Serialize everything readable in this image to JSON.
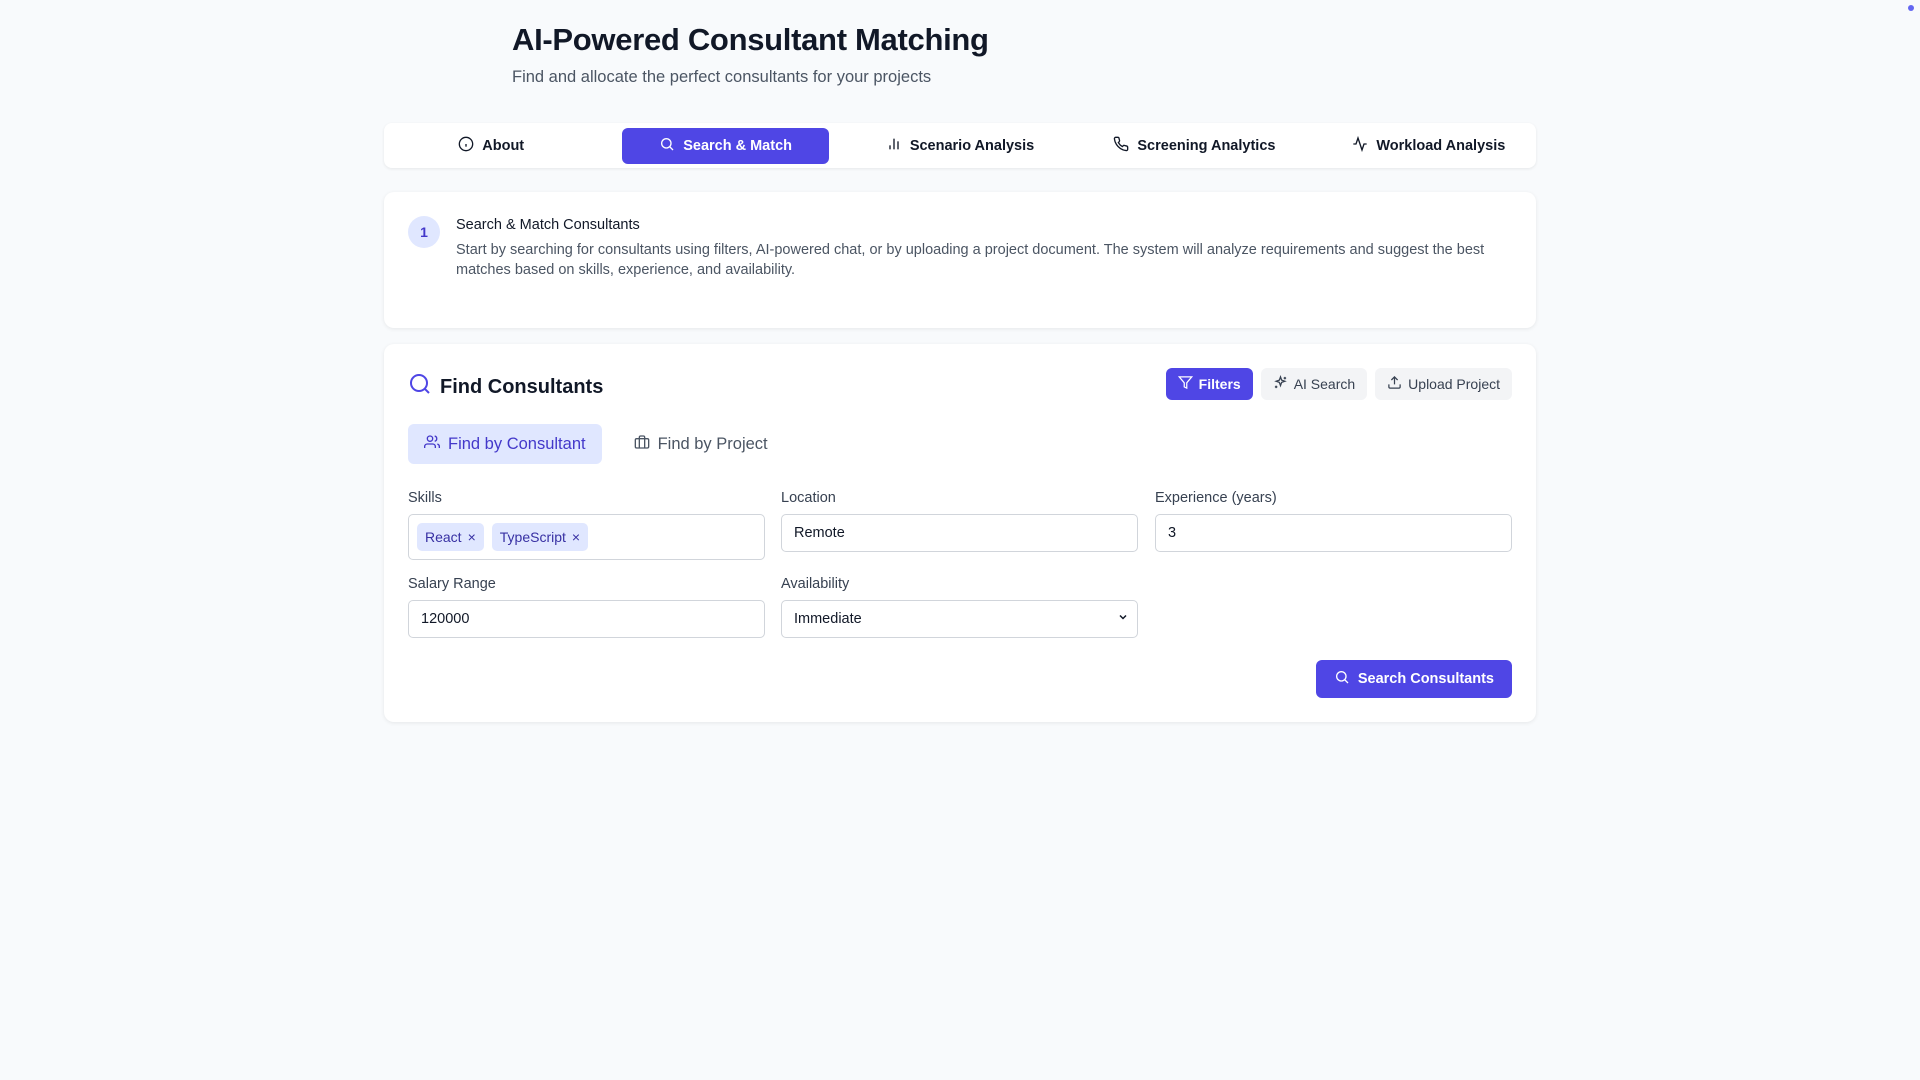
{
  "header": {
    "title": "AI-Powered Consultant Matching",
    "subtitle": "Find and allocate the perfect consultants for your projects"
  },
  "tabs": [
    {
      "label": "About",
      "icon": "info-icon",
      "active": false
    },
    {
      "label": "Search & Match",
      "icon": "search-icon",
      "active": true
    },
    {
      "label": "Scenario Analysis",
      "icon": "bar-chart-icon",
      "active": false
    },
    {
      "label": "Screening Analytics",
      "icon": "phone-icon",
      "active": false
    },
    {
      "label": "Workload Analysis",
      "icon": "activity-icon",
      "active": false
    }
  ],
  "info": {
    "step": "1",
    "title": "Search & Match Consultants",
    "text": "Start by searching for consultants using filters, AI-powered chat, or by uploading a project document. The system will analyze requirements and suggest the best matches based on skills, experience, and availability."
  },
  "find": {
    "title": "Find Consultants",
    "actions": {
      "filters": "Filters",
      "ai_search": "AI Search",
      "upload": "Upload Project"
    },
    "subtabs": {
      "consultant": "Find by Consultant",
      "project": "Find by Project"
    },
    "fields": {
      "skills_label": "Skills",
      "skills": [
        "React",
        "TypeScript"
      ],
      "location_label": "Location",
      "location_value": "Remote",
      "experience_label": "Experience (years)",
      "experience_value": "3",
      "salary_label": "Salary Range",
      "salary_value": "120000",
      "availability_label": "Availability",
      "availability_value": "Immediate"
    },
    "search_button": "Search Consultants"
  },
  "colors": {
    "accent": "#4f46e5",
    "accent_light": "#e0e7ff",
    "background": "#f8fafc"
  }
}
